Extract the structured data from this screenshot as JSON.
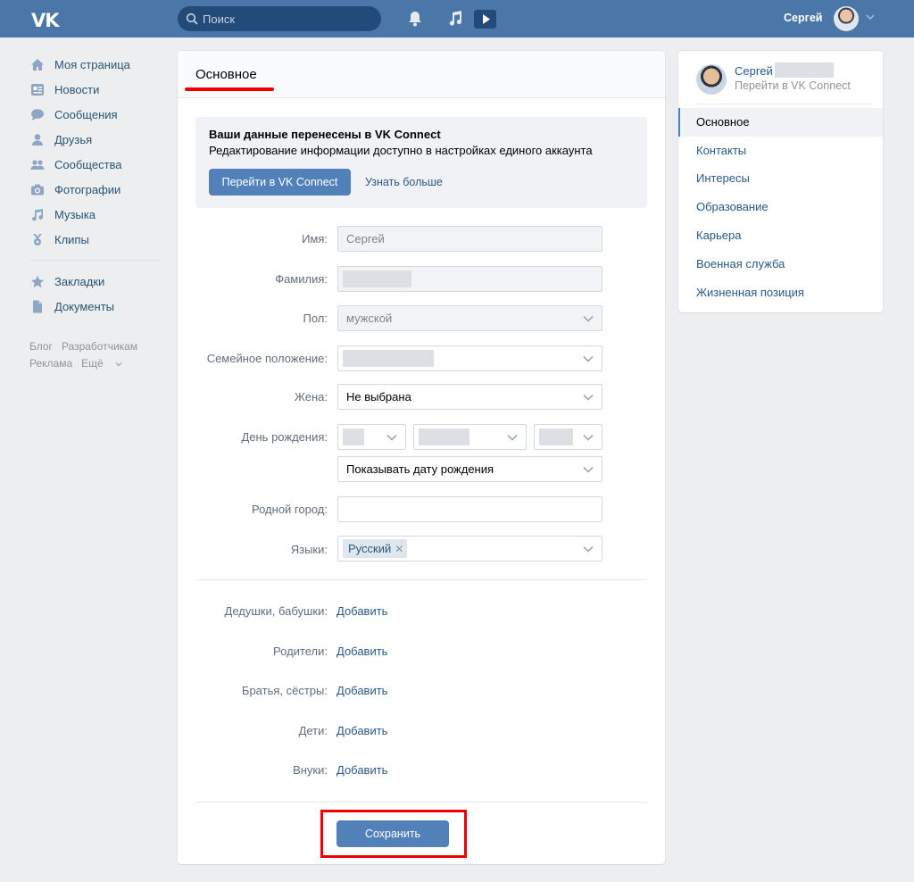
{
  "header": {
    "logo": "VK",
    "search_placeholder": "Поиск",
    "user_name": "Сергей"
  },
  "sidebar": {
    "items": [
      {
        "label": "Моя страница",
        "icon": "home-icon"
      },
      {
        "label": "Новости",
        "icon": "news-icon"
      },
      {
        "label": "Сообщения",
        "icon": "messages-icon"
      },
      {
        "label": "Друзья",
        "icon": "friends-icon"
      },
      {
        "label": "Сообщества",
        "icon": "communities-icon"
      },
      {
        "label": "Фотографии",
        "icon": "photos-icon"
      },
      {
        "label": "Музыка",
        "icon": "music-icon"
      },
      {
        "label": "Клипы",
        "icon": "clips-icon"
      }
    ],
    "items2": [
      {
        "label": "Закладки",
        "icon": "bookmark-icon"
      },
      {
        "label": "Документы",
        "icon": "documents-icon"
      }
    ],
    "footer": [
      "Блог",
      "Разработчикам",
      "Реклама",
      "Ещё"
    ]
  },
  "main": {
    "title": "Основное",
    "notice": {
      "title": "Ваши данные перенесены в VK Connect",
      "subtitle": "Редактирование информации доступно в настройках единого аккаунта",
      "button": "Перейти в VK Connect",
      "link": "Узнать больше"
    },
    "form": {
      "first_name_label": "Имя:",
      "first_name_value": "Сергей",
      "last_name_label": "Фамилия:",
      "gender_label": "Пол:",
      "gender_value": "мужской",
      "marital_label": "Семейное положение:",
      "wife_label": "Жена:",
      "wife_value": "Не выбрана",
      "birthday_label": "День рождения:",
      "birthday_visibility": "Показывать дату рождения",
      "hometown_label": "Родной город:",
      "languages_label": "Языки:",
      "language_tag": "Русский"
    },
    "relatives": [
      {
        "label": "Дедушки, бабушки:",
        "action": "Добавить"
      },
      {
        "label": "Родители:",
        "action": "Добавить"
      },
      {
        "label": "Братья, сёстры:",
        "action": "Добавить"
      },
      {
        "label": "Дети:",
        "action": "Добавить"
      },
      {
        "label": "Внуки:",
        "action": "Добавить"
      }
    ],
    "save_label": "Сохранить"
  },
  "right_menu": {
    "name": "Сергей",
    "sub": "Перейти в VK Connect",
    "items": [
      "Основное",
      "Контакты",
      "Интересы",
      "Образование",
      "Карьера",
      "Военная служба",
      "Жизненная позиция"
    ],
    "active": "Основное"
  },
  "colors": {
    "header_bg": "#4a76a8",
    "accent": "#5181b8",
    "highlight": "#ee0000"
  }
}
